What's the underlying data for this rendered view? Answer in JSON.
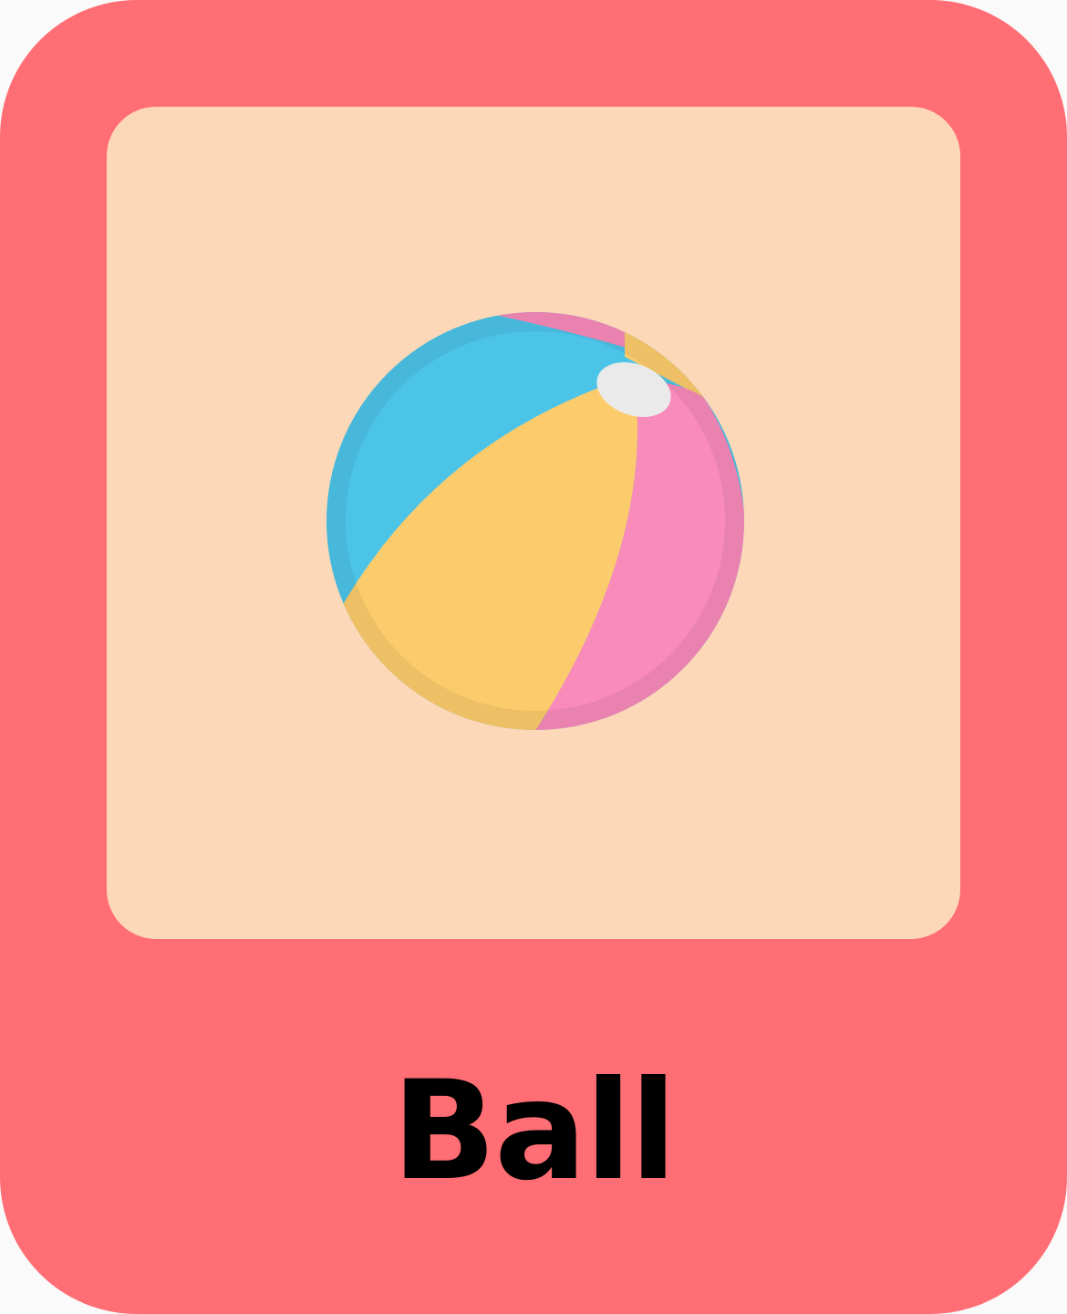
{
  "card": {
    "word": "Ball",
    "icon": "beach-ball-icon"
  },
  "colors": {
    "card_background": "#ff6e74",
    "panel_background": "#fcd8b8",
    "ball_blue": "#4cc4e8",
    "ball_yellow": "#fccc6c",
    "ball_pink": "#f98bbb",
    "ball_cap": "#eaeaea",
    "text": "#000000"
  }
}
